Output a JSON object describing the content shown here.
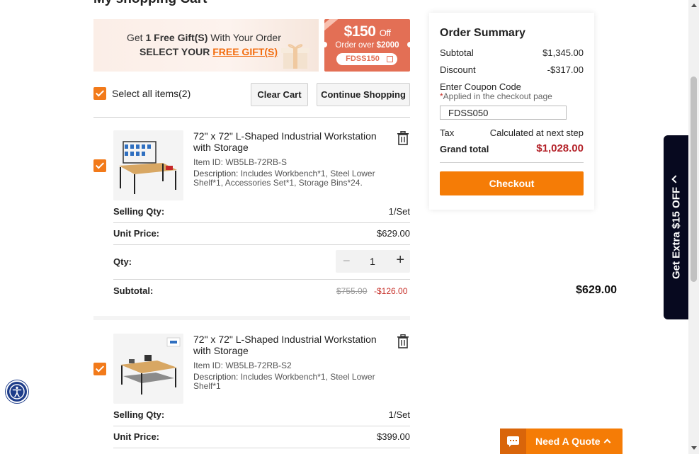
{
  "cart": {
    "title": "My shopping Cart",
    "select_all_label": "Select all items(2)",
    "clear_cart_label": "Clear Cart",
    "continue_shopping_label": "Continue Shopping"
  },
  "gift_banner": {
    "line1_pre": "Get ",
    "line1_bold": "1 Free Gift(S)",
    "line1_post": " With Your Order",
    "line2_pre": "SELECT YOUR ",
    "line2_link": "FREE GIFT(S)"
  },
  "coupon_banner": {
    "amount": "$150",
    "amount_suffix": "Off",
    "order_pre": "Order over ",
    "order_amount": "$2000",
    "code": "FDSS150"
  },
  "items": [
    {
      "title": "72\" x 72\" L-Shaped Industrial Workstation with Storage",
      "item_id": "Item ID: WB5LB-72RB-S",
      "desc_label": "Description:",
      "desc_text": " Includes Workbench*1, Steel Lower Shelf*1, Accessories Set*1, Storage Bins*24.",
      "selling_qty_label": "Selling Qty:",
      "selling_qty_value": "1/Set",
      "unit_price_label": "Unit Price:",
      "unit_price_value": "$629.00",
      "qty_label": "Qty:",
      "qty_value": "1",
      "subtotal_label": "Subtotal:",
      "subtotal_value": "$629.00",
      "subtotal_original": "$755.00",
      "subtotal_discount": "-$126.00"
    },
    {
      "title": "72\" x 72\" L-Shaped Industrial Workstation with Storage",
      "item_id": "Item ID: WB5LB-72RB-S2",
      "desc_label": "Description:",
      "desc_text": " Includes Workbench*1, Steel Lower Shelf*1",
      "selling_qty_label": "Selling Qty:",
      "selling_qty_value": "1/Set",
      "unit_price_label": "Unit Price:",
      "unit_price_value": "$399.00"
    }
  ],
  "summary": {
    "title": "Order Summary",
    "subtotal_label": "Subtotal",
    "subtotal_value": "$1,345.00",
    "discount_label": "Discount",
    "discount_value": "-$317.00",
    "coupon_label": "Enter Coupon Code",
    "coupon_note_star": "*",
    "coupon_note": "Applied in the checkout page",
    "coupon_value": "FDSS050",
    "tax_label": "Tax",
    "tax_value": "Calculated at next step",
    "grand_label": "Grand total",
    "grand_value": "$1,028.00",
    "checkout_label": "Checkout"
  },
  "side_tab": {
    "label": "Get Extra $15 OFF"
  },
  "quote": {
    "label": "Need A Quote"
  },
  "colors": {
    "accent": "#f57c06",
    "price_red": "#b4232a",
    "side_tab_bg": "#07091f",
    "coupon_bg": "#e36f55"
  },
  "icons": [
    "checkbox-icon",
    "trash-icon",
    "copy-icon",
    "chat-icon",
    "accessibility-icon",
    "chevron-up-icon",
    "minus-icon",
    "plus-icon",
    "gift-box-icon"
  ]
}
